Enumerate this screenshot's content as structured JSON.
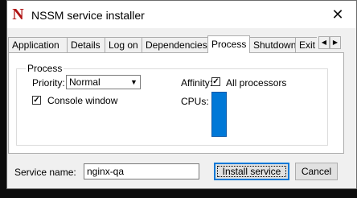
{
  "window": {
    "title": "NSSM service installer",
    "icon": "nssm-app-icon",
    "close_glyph": "✕"
  },
  "tabs": [
    {
      "label": "Application",
      "active": false
    },
    {
      "label": "Details",
      "active": false
    },
    {
      "label": "Log on",
      "active": false
    },
    {
      "label": "Dependencies",
      "active": false
    },
    {
      "label": "Process",
      "active": true
    },
    {
      "label": "Shutdown",
      "active": false
    },
    {
      "label": "Exit",
      "active": false
    }
  ],
  "tab_scroll": {
    "left_glyph": "◀",
    "right_glyph": "▶"
  },
  "process": {
    "group_label": "Process",
    "priority_label": "Priority:",
    "priority_value": "Normal",
    "console_window_label": "Console window",
    "console_window_checked": true,
    "affinity_label": "Affinity:",
    "all_processors_label": "All processors",
    "all_processors_checked": true,
    "cpus_label": "CPUs:"
  },
  "footer": {
    "service_name_label": "Service name:",
    "service_name_value": "nginx-qa",
    "install_button": "Install service",
    "cancel_button": "Cancel"
  },
  "colors": {
    "selection": "#0078d7",
    "icon_red": "#b01414"
  }
}
